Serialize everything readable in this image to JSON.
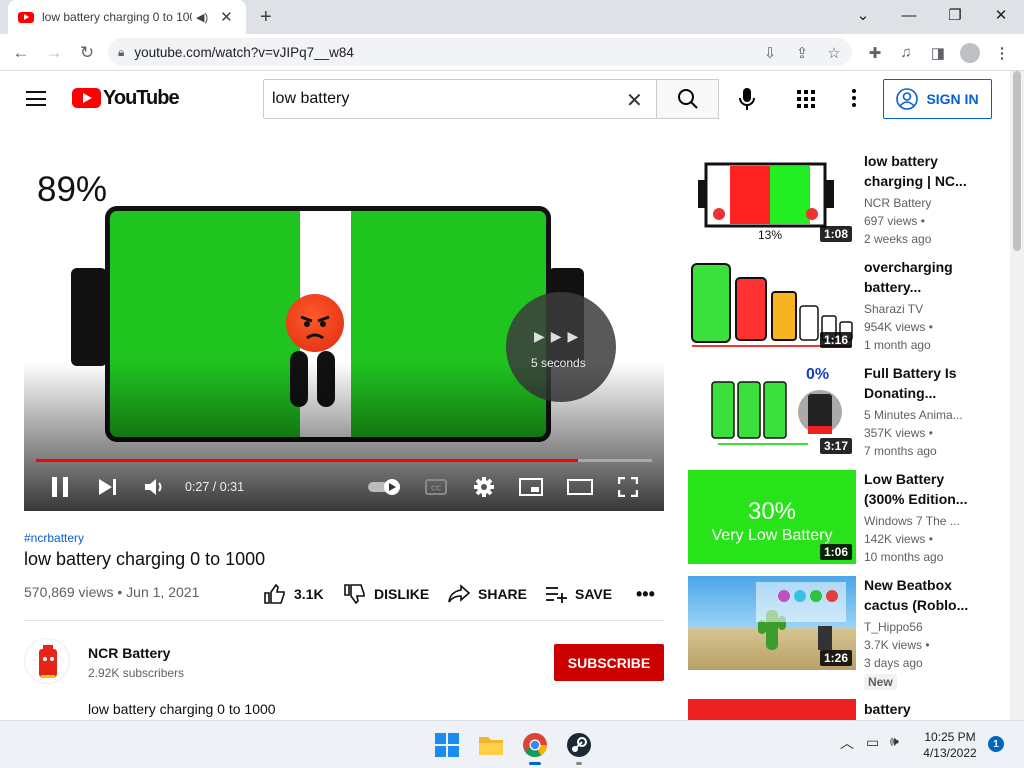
{
  "browser": {
    "tab_title": "low battery charging 0 to 100",
    "url": "youtube.com/watch?v=vJIPq7__w84"
  },
  "header": {
    "logo_text": "YouTube",
    "search_value": "low battery",
    "signin_label": "SIGN IN"
  },
  "player": {
    "overlay_percent": "89%",
    "skip_text": "5 seconds",
    "time": "0:27 / 0:31",
    "progress": 0.88
  },
  "video": {
    "hashtag": "#ncrbattery",
    "title": "low battery charging 0 to 1000",
    "stats": "570,869 views • Jun 1, 2021",
    "likes": "3.1K",
    "dislike_label": "DISLIKE",
    "share_label": "SHARE",
    "save_label": "SAVE",
    "channel_name": "NCR Battery",
    "channel_subs": "2.92K subscribers",
    "subscribe_label": "SUBSCRIBE",
    "description": "low battery charging 0 to 1000"
  },
  "related": [
    {
      "title": "low battery charging | NC...",
      "channel": "NCR Battery",
      "views": "697 views •",
      "ago": "2 weeks ago",
      "duration": "1:08",
      "thumb_text": "13%"
    },
    {
      "title": "overcharging battery...",
      "channel": "Sharazi TV",
      "views": "954K views •",
      "ago": "1 month ago",
      "duration": "1:16"
    },
    {
      "title": "Full Battery Is Donating...",
      "channel": "5 Minutes Anima...",
      "views": "357K views •",
      "ago": "7 months ago",
      "duration": "3:17",
      "thumb_text": "0%"
    },
    {
      "title": "Low Battery (300% Edition...",
      "channel": "Windows 7 The ...",
      "views": "142K views •",
      "ago": "10 months ago",
      "duration": "1:06",
      "thumb_text": "30%",
      "thumb_sub": "Very Low Battery"
    },
    {
      "title": "New Beatbox cactus (Roblo...",
      "channel": "T_Hippo56",
      "views": "3.7K views •",
      "ago": "3 days ago",
      "duration": "1:26",
      "badge": "New"
    },
    {
      "title": "battery"
    }
  ],
  "taskbar": {
    "time": "10:25 PM",
    "date": "4/13/2022",
    "notifications": "1"
  }
}
